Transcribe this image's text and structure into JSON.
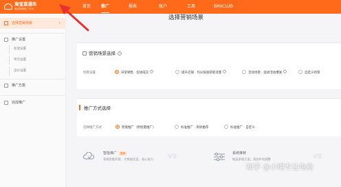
{
  "header": {
    "logo_title": "淘宝直通车",
    "logo_subtitle": "精准营销推广平台",
    "nav": [
      "首页",
      "推广",
      "报表",
      "账户",
      "工具",
      "BINICLUB"
    ],
    "active_nav": "推广"
  },
  "sidebar": {
    "create_plan": "选择营销场景",
    "group_label": "推广设置",
    "sub_items": [
      "投放设置",
      "单元设置",
      "出价设置"
    ],
    "item_plan": "推广方案",
    "item_done": "完成推广"
  },
  "main": {
    "page_title": "选择营销场景",
    "scene_section": {
      "title": "营销场景选择",
      "row_label": "场景设置",
      "options": [
        "日常销售 · 促进成交",
        "提升店铺 · 均分快速获取流量",
        "活动场景 · 促进活动爆发",
        "自定义场景"
      ],
      "selected_index": 0
    },
    "method_section": {
      "title": "推广方式选择",
      "row_label": "选择推广方式",
      "options": [
        "智能推广（原批量推广）",
        "标准推广 · 系统推荐",
        "标准推广 · 自定义"
      ],
      "selected_index": 0
    },
    "features": [
      {
        "title": "智能推广",
        "tag": "推荐",
        "desc": "系统智能托管、大数据优选、省心省力"
      },
      {
        "title": "系统推荐",
        "tag": "",
        "desc": "推送系统方案，再加手动调整"
      }
    ],
    "vs_label": "VS"
  },
  "watermark": "知乎 @小明专注电商",
  "colors": {
    "brand": "#ff6a1a",
    "annotation_arrow": "#e8302f"
  },
  "icons": [
    "shop-logo-icon",
    "rocket-icon",
    "settings-icon",
    "plan-icon",
    "done-icon",
    "intelligent-icon",
    "sliders-icon"
  ]
}
